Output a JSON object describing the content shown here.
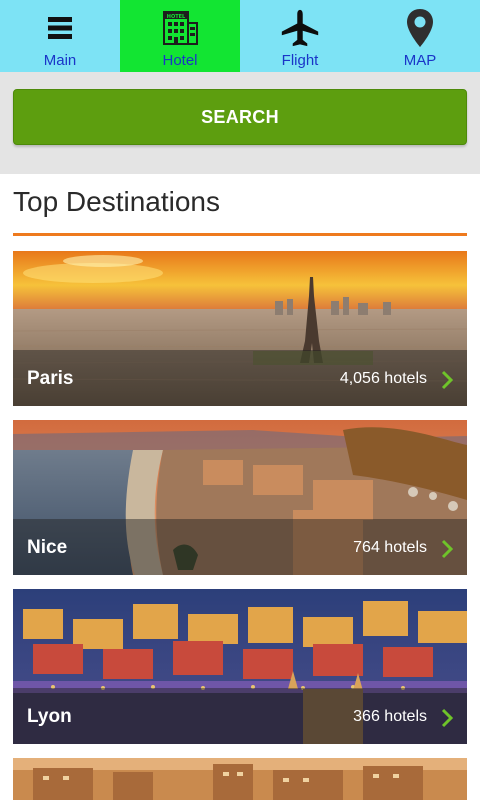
{
  "tabs": [
    {
      "label": "Main",
      "icon": "menu-icon",
      "active": false
    },
    {
      "label": "Hotel",
      "icon": "hotel-icon",
      "active": true
    },
    {
      "label": "Flight",
      "icon": "airplane-icon",
      "active": false
    },
    {
      "label": "MAP",
      "icon": "map-pin-icon",
      "active": false
    }
  ],
  "search": {
    "label": "SEARCH"
  },
  "section": {
    "title": "Top Destinations"
  },
  "destinations": [
    {
      "city": "Paris",
      "hotels": "4,056 hotels"
    },
    {
      "city": "Nice",
      "hotels": "764 hotels"
    },
    {
      "city": "Lyon",
      "hotels": "366 hotels"
    }
  ],
  "hotel_sign_text": "HOTEL",
  "colors": {
    "tabbar": "#7de3f5",
    "active_tab": "#12e532",
    "tab_label": "#1a35c8",
    "search_button": "#5d9e0f",
    "accent_rule": "#ee7a1e",
    "chevron": "#6fc42a"
  }
}
